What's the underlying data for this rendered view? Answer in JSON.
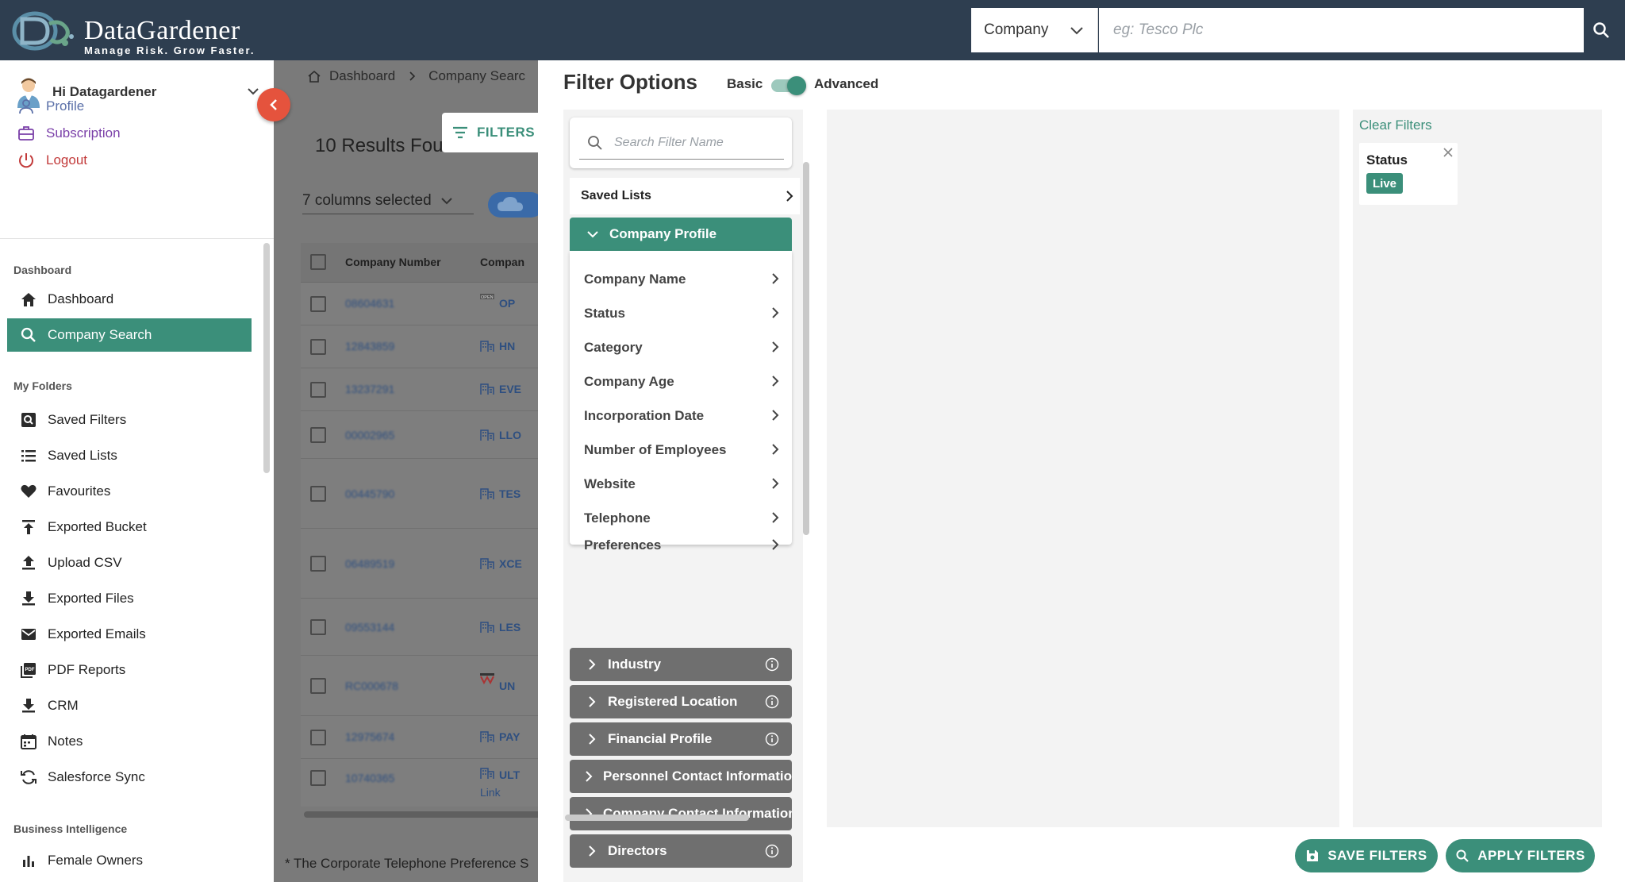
{
  "app": {
    "logo_name": "DataGardener",
    "logo_tagline": "Manage Risk. Grow Faster.",
    "brand_color": "#2e3e50",
    "accent_color": "#3b8f7a"
  },
  "search": {
    "type_value": "Company",
    "placeholder": "eg: Tesco Plc",
    "value": ""
  },
  "sidebar": {
    "greeting": "Hi Datagardener",
    "account_links": [
      {
        "label": "Profile",
        "icon": "user-icon"
      },
      {
        "label": "Subscription",
        "icon": "briefcase-icon"
      },
      {
        "label": "Logout",
        "icon": "power-icon"
      }
    ],
    "sections": {
      "dashboard": "Dashboard",
      "my_folders": "My Folders",
      "business_intelligence": "Business Intelligence"
    },
    "dashboard_items": [
      {
        "label": "Dashboard",
        "icon": "home-icon",
        "active": false
      },
      {
        "label": "Company Search",
        "icon": "search-icon",
        "active": true
      }
    ],
    "folder_items": [
      {
        "label": "Saved Filters",
        "icon": "saved-filter-icon"
      },
      {
        "label": "Saved Lists",
        "icon": "list-icon"
      },
      {
        "label": "Favourites",
        "icon": "heart-icon"
      },
      {
        "label": "Exported Bucket",
        "icon": "upload-bucket-icon"
      },
      {
        "label": "Upload CSV",
        "icon": "upload-icon"
      },
      {
        "label": "Exported Files",
        "icon": "download-icon"
      },
      {
        "label": "Exported Emails",
        "icon": "mail-icon"
      },
      {
        "label": "PDF Reports",
        "icon": "pdf-icon"
      },
      {
        "label": "CRM",
        "icon": "download-icon"
      },
      {
        "label": "Notes",
        "icon": "calendar-icon"
      },
      {
        "label": "Salesforce Sync",
        "icon": "sync-icon"
      }
    ],
    "bi_items": [
      {
        "label": "Female Owners",
        "icon": "bar-chart-icon"
      }
    ]
  },
  "content": {
    "breadcrumb": [
      "Dashboard",
      "Company Searc"
    ],
    "results_count": "10 Results Fou",
    "filters_button": "FILTERS",
    "columns_selected": "7 columns selected",
    "table_headers": [
      "Company Number",
      "Compan"
    ],
    "rows": [
      {
        "number": "08604631",
        "name": "OP"
      },
      {
        "number": "12843859",
        "name": "HN"
      },
      {
        "number": "13237291",
        "name": "EVE"
      },
      {
        "number": "00002965",
        "name": "LLO"
      },
      {
        "number": "00445790",
        "name": "TES"
      },
      {
        "number": "06489519",
        "name": "XCE"
      },
      {
        "number": "09553144",
        "name": "LES"
      },
      {
        "number": "RC000678",
        "name": "UN"
      },
      {
        "number": "12975674",
        "name": "PAY"
      },
      {
        "number": "10740365",
        "name": "ULT",
        "sub": "Link"
      }
    ],
    "footnote": "* The Corporate Telephone Preference S"
  },
  "filter_panel": {
    "title": "Filter Options",
    "mode_basic": "Basic",
    "mode_advanced": "Advanced",
    "mode_is_advanced": true,
    "search_placeholder": "Search Filter Name",
    "saved_lists": "Saved Lists",
    "company_profile": {
      "label": "Company Profile",
      "items": [
        "Company Name",
        "Status",
        "Category",
        "Company Age",
        "Incorporation Date",
        "Number of Employees",
        "Website",
        "Telephone",
        "Preferences"
      ]
    },
    "groups": [
      {
        "label": "Industry",
        "info": true
      },
      {
        "label": "Registered Location",
        "info": true
      },
      {
        "label": "Financial Profile",
        "info": true
      },
      {
        "label": "Personnel Contact Informatio",
        "info": false
      },
      {
        "label": "Company Contact Information",
        "info": false
      },
      {
        "label": "Directors",
        "info": true
      }
    ],
    "clear_filters": "Clear Filters",
    "applied": {
      "title": "Status",
      "value": "Live"
    },
    "save_button": "SAVE FILTERS",
    "apply_button": "APPLY FILTERS"
  }
}
